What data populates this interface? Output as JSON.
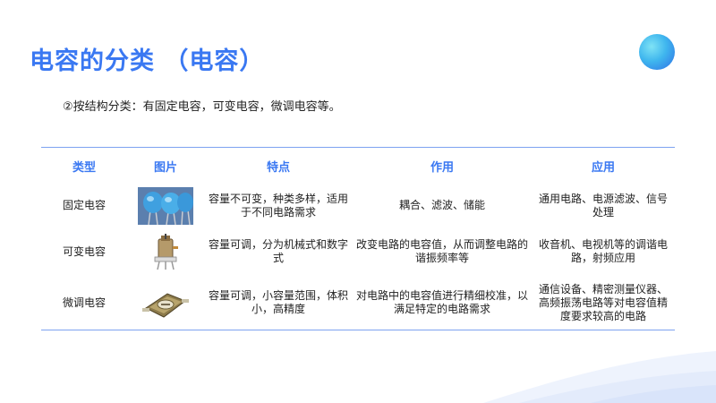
{
  "slide": {
    "title": "电容的分类 （电容）",
    "subtitle": "②按结构分类：有固定电容，可变电容，微调电容等。"
  },
  "table": {
    "headers": [
      "类型",
      "图片",
      "特点",
      "作用",
      "应用"
    ],
    "rows": [
      {
        "type": "固定电容",
        "image_icon": "fixed-capacitor-icon",
        "feature": "容量不可变，种类多样，适用于不同电路需求",
        "function": "耦合、滤波、储能",
        "application": "通用电路、电源滤波、信号处理"
      },
      {
        "type": "可变电容",
        "image_icon": "variable-capacitor-icon",
        "feature": "容量可调，分为机械式和数字式",
        "function": "改变电路的电容值，从而调整电路的谐振频率等",
        "application": "收音机、电视机等的调谐电路，射频应用"
      },
      {
        "type": "微调电容",
        "image_icon": "trimmer-capacitor-icon",
        "feature": "容量可调，小容量范围，体积小，高精度",
        "function": "对电路中的电容值进行精细校准，以满足特定的电路需求",
        "application": "通信设备、精密测量仪器、高频振荡电路等对电容值精度要求较高的电路"
      }
    ]
  },
  "colors": {
    "accent": "#3a78f2",
    "table_rule": "#7da2f0",
    "text": "#222222"
  }
}
